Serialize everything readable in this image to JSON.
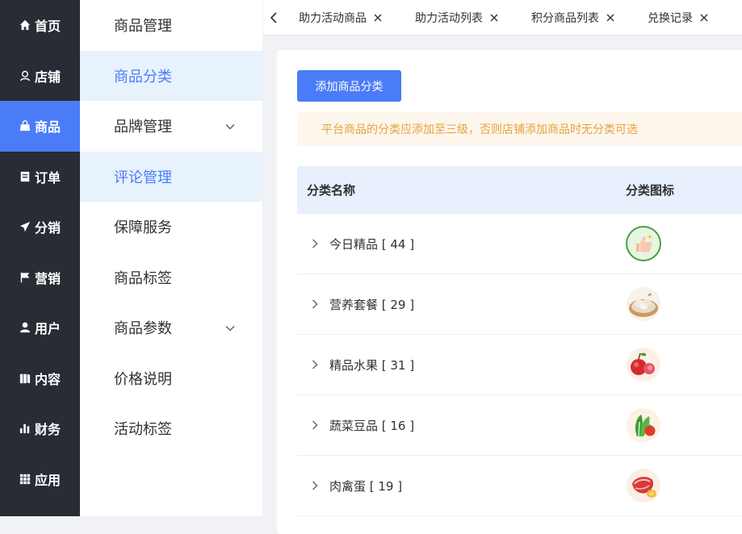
{
  "nav": {
    "items": [
      {
        "label": "首页",
        "icon": "home-icon"
      },
      {
        "label": "店铺",
        "icon": "shop-icon"
      },
      {
        "label": "商品",
        "icon": "bag-icon",
        "active": true
      },
      {
        "label": "订单",
        "icon": "order-icon"
      },
      {
        "label": "分销",
        "icon": "send-icon"
      },
      {
        "label": "营销",
        "icon": "flag-icon"
      },
      {
        "label": "用户",
        "icon": "user-icon"
      },
      {
        "label": "内容",
        "icon": "book-icon"
      },
      {
        "label": "财务",
        "icon": "chart-icon"
      },
      {
        "label": "应用",
        "icon": "grid-icon"
      }
    ]
  },
  "submenu": {
    "items": [
      {
        "label": "商品管理"
      },
      {
        "label": "商品分类",
        "active": true
      },
      {
        "label": "品牌管理",
        "has_children": true
      },
      {
        "label": "评论管理",
        "active": true
      },
      {
        "label": "保障服务"
      },
      {
        "label": "商品标签"
      },
      {
        "label": "商品参数",
        "has_children": true
      },
      {
        "label": "价格说明"
      },
      {
        "label": "活动标签"
      }
    ]
  },
  "tabs": [
    {
      "label": "助力活动商品"
    },
    {
      "label": "助力活动列表"
    },
    {
      "label": "积分商品列表"
    },
    {
      "label": "兑换记录"
    }
  ],
  "main": {
    "add_button": "添加商品分类",
    "notice": "平台商品的分类应添加至三级，否则店铺添加商品时无分类可选",
    "columns": {
      "name": "分类名称",
      "icon": "分类图标"
    },
    "rows": [
      {
        "name": "今日精品 [ 44 ]",
        "icon": "thumbs-up-icon"
      },
      {
        "name": "营养套餐 [ 29 ]",
        "icon": "chicken-icon"
      },
      {
        "name": "精品水果 [ 31 ]",
        "icon": "fruit-icon"
      },
      {
        "name": "蔬菜豆品 [ 16 ]",
        "icon": "vegetable-icon"
      },
      {
        "name": "肉禽蛋 [ 19 ]",
        "icon": "meat-icon"
      }
    ]
  },
  "colors": {
    "accent": "#4a7cf7",
    "nav_bg": "#282c34",
    "notice_bg": "#fdf6ec",
    "notice_text": "#e6a23c"
  }
}
